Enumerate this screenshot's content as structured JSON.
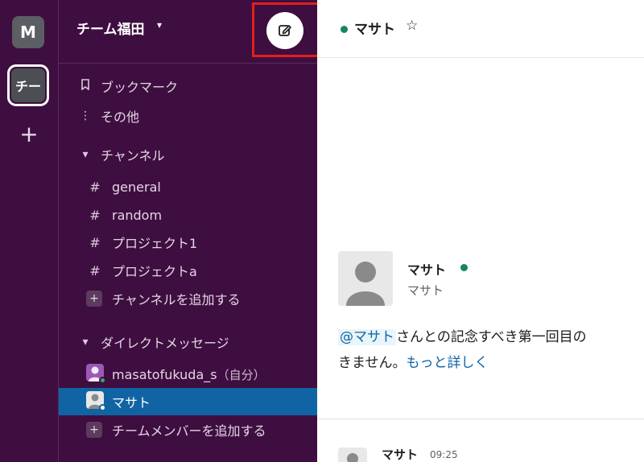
{
  "workspace_rail": {
    "workspaces": [
      {
        "initial": "M"
      },
      {
        "initial": "チー"
      }
    ],
    "add_label": "+"
  },
  "sidebar": {
    "team_name": "チーム福田",
    "nav": {
      "bookmarks": "ブックマーク",
      "more": "その他"
    },
    "channels": {
      "header": "チャンネル",
      "items": [
        "general",
        "random",
        "プロジェクト1",
        "プロジェクトa"
      ],
      "add_label": "チャンネルを追加する"
    },
    "dms": {
      "header": "ダイレクトメッセージ",
      "self_name": "masatofukuda_s",
      "self_suffix": "（自分）",
      "contact": "マサト",
      "add_label": "チームメンバーを追加する"
    }
  },
  "main": {
    "header": {
      "title": "マサト"
    },
    "profile": {
      "name": "マサト",
      "subtitle": "マサト"
    },
    "intro": {
      "mention": "@マサト",
      "text_line1": "さんとの記念すべき第一回目の",
      "text_line2": "きません。",
      "learn_more": "もっと詳しく"
    },
    "message": {
      "author": "マサト",
      "time": "09:25"
    }
  },
  "colors": {
    "sidebar_bg": "#3f0e40",
    "active_item": "#1164a3",
    "online": "#148567",
    "highlight_box": "#e0201a",
    "link": "#1264a3"
  },
  "icons": [
    "plus-icon",
    "chevron-down-icon",
    "compose-icon",
    "bookmark-icon",
    "more-vertical-icon",
    "caret-down-icon",
    "hash-icon",
    "star-icon",
    "user-avatar-icon"
  ]
}
